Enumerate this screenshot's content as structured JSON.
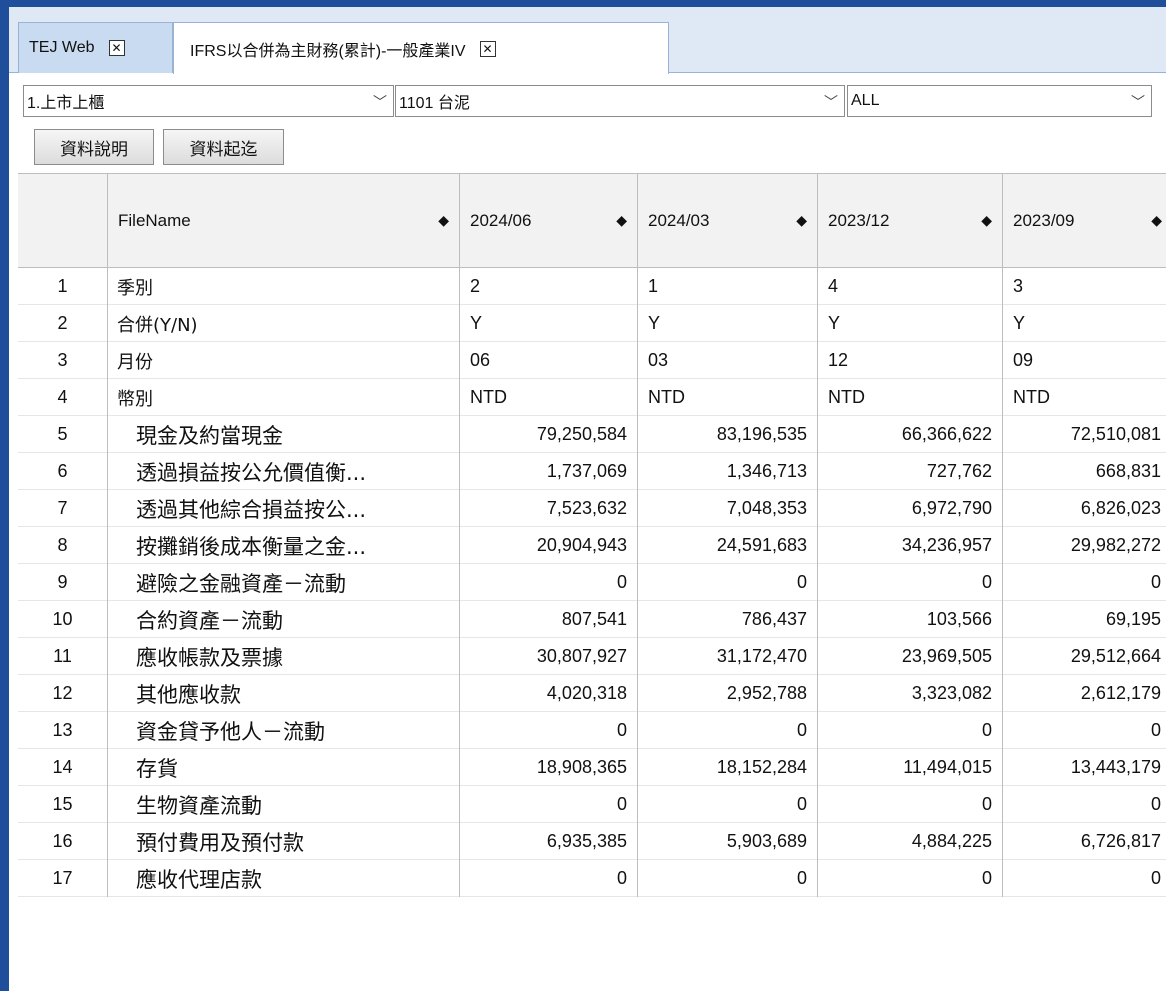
{
  "tabs": [
    {
      "label": "TEJ Web"
    },
    {
      "label": "IFRS以合併為主財務(累計)-一般產業IV"
    }
  ],
  "selectors": {
    "market": "1.上市上櫃",
    "company": "1101 台泥",
    "filter": "ALL"
  },
  "buttons": {
    "data_desc": "資料說明",
    "data_range": "資料起迄"
  },
  "grid": {
    "header": {
      "idx": "",
      "filename": "FileName",
      "periods": [
        "2024/06",
        "2024/03",
        "2023/12",
        "2023/09"
      ]
    },
    "rows": [
      {
        "idx": "1",
        "name": "季別",
        "values": [
          "2",
          "1",
          "4",
          "3"
        ]
      },
      {
        "idx": "2",
        "name": "合併(Y/N)",
        "values": [
          "Y",
          "Y",
          "Y",
          "Y"
        ]
      },
      {
        "idx": "3",
        "name": "月份",
        "values": [
          "06",
          "03",
          "12",
          "09"
        ]
      },
      {
        "idx": "4",
        "name": "幣別",
        "values": [
          "NTD",
          "NTD",
          "NTD",
          "NTD"
        ]
      },
      {
        "idx": "5",
        "name": "現金及約當現金",
        "values": [
          "79,250,584",
          "83,196,535",
          "66,366,622",
          "72,510,081"
        ]
      },
      {
        "idx": "6",
        "name": "透過損益按公允價值衡...",
        "values": [
          "1,737,069",
          "1,346,713",
          "727,762",
          "668,831"
        ]
      },
      {
        "idx": "7",
        "name": "透過其他綜合損益按公...",
        "values": [
          "7,523,632",
          "7,048,353",
          "6,972,790",
          "6,826,023"
        ]
      },
      {
        "idx": "8",
        "name": "按攤銷後成本衡量之金...",
        "values": [
          "20,904,943",
          "24,591,683",
          "34,236,957",
          "29,982,272"
        ]
      },
      {
        "idx": "9",
        "name": "避險之金融資產－流動",
        "values": [
          "0",
          "0",
          "0",
          "0"
        ]
      },
      {
        "idx": "10",
        "name": "合約資產－流動",
        "values": [
          "807,541",
          "786,437",
          "103,566",
          "69,195"
        ]
      },
      {
        "idx": "11",
        "name": "應收帳款及票據",
        "values": [
          "30,807,927",
          "31,172,470",
          "23,969,505",
          "29,512,664"
        ]
      },
      {
        "idx": "12",
        "name": "其他應收款",
        "values": [
          "4,020,318",
          "2,952,788",
          "3,323,082",
          "2,612,179"
        ]
      },
      {
        "idx": "13",
        "name": "資金貸予他人－流動",
        "values": [
          "0",
          "0",
          "0",
          "0"
        ]
      },
      {
        "idx": "14",
        "name": "存貨",
        "values": [
          "18,908,365",
          "18,152,284",
          "11,494,015",
          "13,443,179"
        ]
      },
      {
        "idx": "15",
        "name": "生物資產流動",
        "values": [
          "0",
          "0",
          "0",
          "0"
        ]
      },
      {
        "idx": "16",
        "name": "預付費用及預付款",
        "values": [
          "6,935,385",
          "5,903,689",
          "4,884,225",
          "6,726,817"
        ]
      },
      {
        "idx": "17",
        "name": "應收代理店款",
        "values": [
          "0",
          "0",
          "0",
          "0"
        ]
      }
    ]
  }
}
